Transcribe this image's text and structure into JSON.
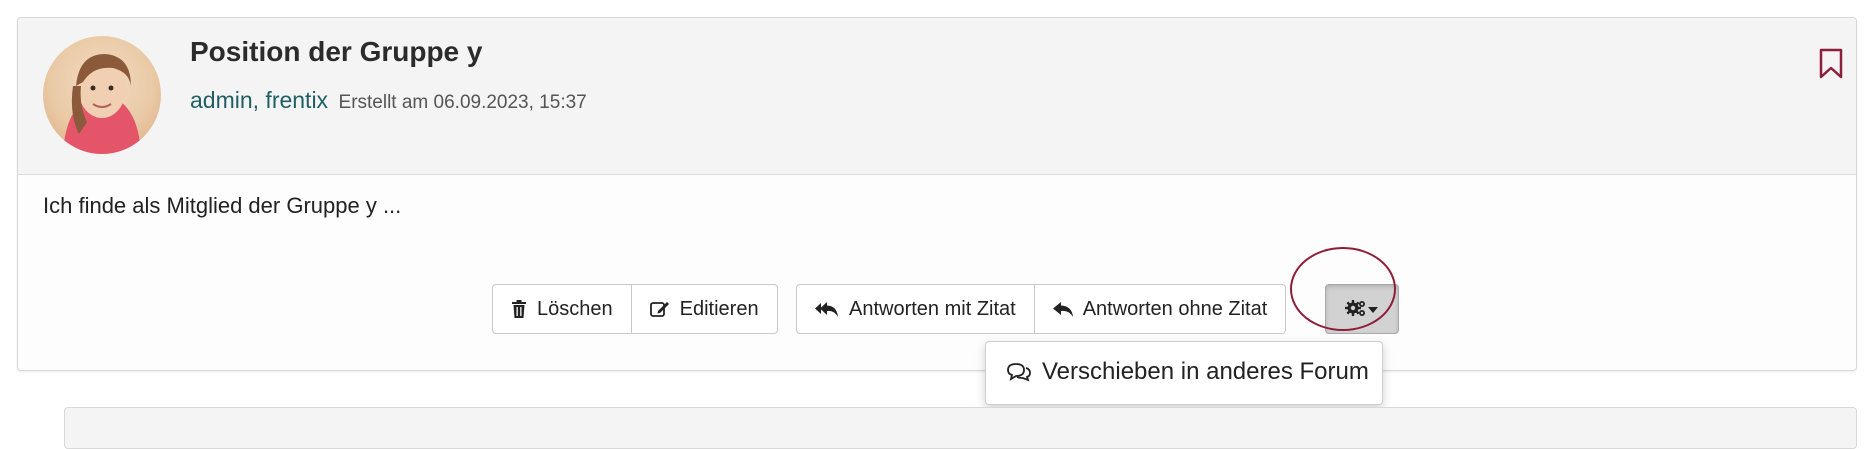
{
  "post": {
    "title": "Position der Gruppe y",
    "authors": "admin, frentix",
    "created": "Erstellt am 06.09.2023, 15:37",
    "body": "Ich finde als Mitglied der Gruppe y ..."
  },
  "actions": {
    "delete_label": "Löschen",
    "edit_label": "Editieren",
    "reply_quote_label": "Antworten mit Zitat",
    "reply_noquote_label": "Antworten ohne Zitat"
  },
  "dropdown": {
    "move_label": "Verschieben in anderes Forum"
  },
  "icons": {
    "bookmark": "bookmark-icon",
    "delete": "trash-icon",
    "edit": "edit-icon",
    "reply_quote": "reply-all-icon",
    "reply_noquote": "reply-icon",
    "tools": "gears-icon",
    "move": "comments-icon"
  },
  "colors": {
    "accent": "#8e1f3b",
    "author_link": "#1f5f63"
  }
}
